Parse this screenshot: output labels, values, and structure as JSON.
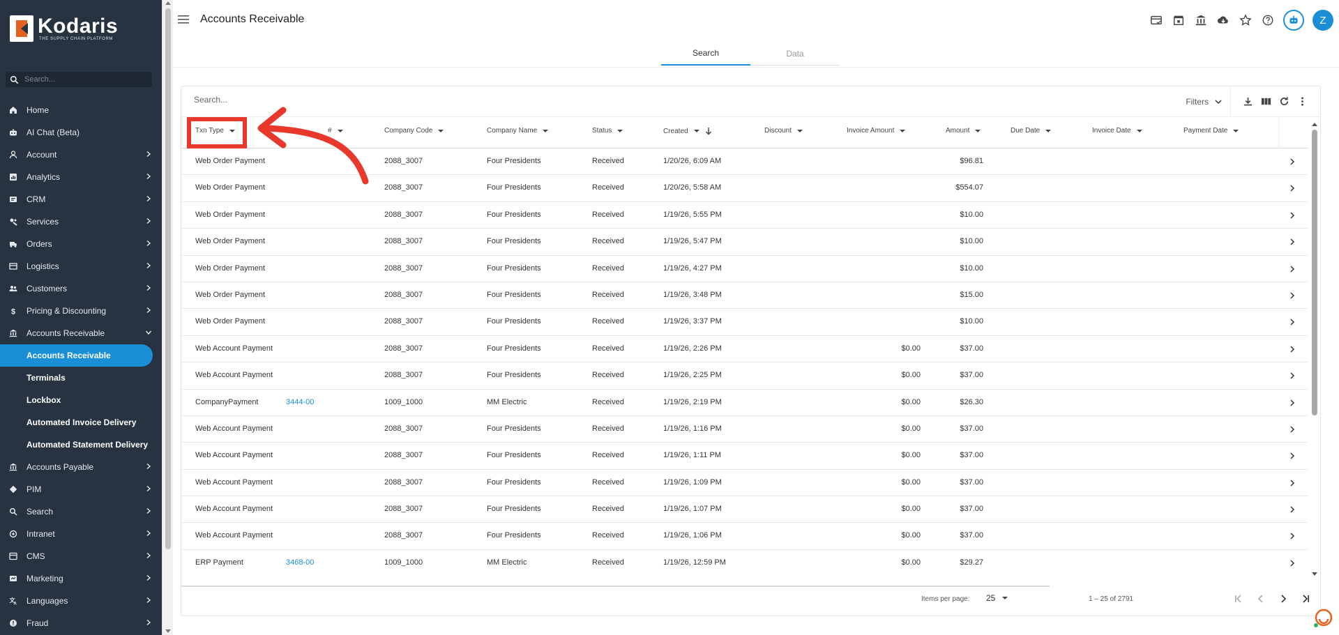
{
  "brand": {
    "name": "Kodaris",
    "tagline": "THE SUPPLY CHAIN PLATFORM"
  },
  "sidebar": {
    "search_placeholder": "Search...",
    "items": [
      {
        "label": "Home",
        "icon": "home-icon",
        "has_chevron": false
      },
      {
        "label": "AI Chat (Beta)",
        "icon": "robot-icon",
        "has_chevron": false
      },
      {
        "label": "Account",
        "icon": "person-icon",
        "has_chevron": true
      },
      {
        "label": "Analytics",
        "icon": "analytics-icon",
        "has_chevron": true
      },
      {
        "label": "CRM",
        "icon": "crm-icon",
        "has_chevron": true
      },
      {
        "label": "Services",
        "icon": "services-icon",
        "has_chevron": true
      },
      {
        "label": "Orders",
        "icon": "truck-icon",
        "has_chevron": true
      },
      {
        "label": "Logistics",
        "icon": "logistics-icon",
        "has_chevron": true
      },
      {
        "label": "Customers",
        "icon": "people-icon",
        "has_chevron": true
      },
      {
        "label": "Pricing & Discounting",
        "icon": "dollar-icon",
        "has_chevron": true
      },
      {
        "label": "Accounts Receivable",
        "icon": "bank-icon",
        "has_chevron": true,
        "expanded": true
      }
    ],
    "sub_items": [
      {
        "label": "Accounts Receivable",
        "active": true
      },
      {
        "label": "Terminals",
        "active": false
      },
      {
        "label": "Lockbox",
        "active": false
      },
      {
        "label": "Automated Invoice Delivery",
        "active": false
      },
      {
        "label": "Automated Statement Delivery",
        "active": false
      }
    ],
    "items_after": [
      {
        "label": "Accounts Payable",
        "icon": "bank-icon",
        "has_chevron": true
      },
      {
        "label": "PIM",
        "icon": "tag-icon",
        "has_chevron": true
      },
      {
        "label": "Search",
        "icon": "search-icon",
        "has_chevron": true
      },
      {
        "label": "Intranet",
        "icon": "intranet-icon",
        "has_chevron": true
      },
      {
        "label": "CMS",
        "icon": "cms-icon",
        "has_chevron": true
      },
      {
        "label": "Marketing",
        "icon": "marketing-icon",
        "has_chevron": true
      },
      {
        "label": "Languages",
        "icon": "translate-icon",
        "has_chevron": true
      },
      {
        "label": "Fraud",
        "icon": "alert-icon",
        "has_chevron": true
      }
    ]
  },
  "header": {
    "title": "Accounts Receivable",
    "icons": [
      "payment-card-icon",
      "storefront-icon",
      "bank-icon",
      "cloud-download-icon",
      "star-icon",
      "help-icon"
    ],
    "avatar_initial": "Z"
  },
  "tabs": [
    {
      "label": "Search",
      "active": true
    },
    {
      "label": "Data",
      "active": false
    }
  ],
  "grid": {
    "search_placeholder": "Search...",
    "filters_label": "Filters",
    "columns": [
      {
        "label": "Txn Type"
      },
      {
        "label": "#"
      },
      {
        "label": "Company Code"
      },
      {
        "label": "Company Name"
      },
      {
        "label": "Status"
      },
      {
        "label": "Created",
        "sorted": "desc"
      },
      {
        "label": "Discount"
      },
      {
        "label": "Invoice Amount"
      },
      {
        "label": "Amount"
      },
      {
        "label": "Due Date"
      },
      {
        "label": "Invoice Date"
      },
      {
        "label": "Payment Date"
      }
    ],
    "rows": [
      {
        "txn_type": "Web Order Payment",
        "num": "",
        "company_code": "2088_3007",
        "company_name": "Four Presidents",
        "status": "Received",
        "created": "1/20/26, 6:09 AM",
        "invoice_amount": "",
        "amount": "$96.81"
      },
      {
        "txn_type": "Web Order Payment",
        "num": "",
        "company_code": "2088_3007",
        "company_name": "Four Presidents",
        "status": "Received",
        "created": "1/20/26, 5:58 AM",
        "invoice_amount": "",
        "amount": "$554.07"
      },
      {
        "txn_type": "Web Order Payment",
        "num": "",
        "company_code": "2088_3007",
        "company_name": "Four Presidents",
        "status": "Received",
        "created": "1/19/26, 5:55 PM",
        "invoice_amount": "",
        "amount": "$10.00"
      },
      {
        "txn_type": "Web Order Payment",
        "num": "",
        "company_code": "2088_3007",
        "company_name": "Four Presidents",
        "status": "Received",
        "created": "1/19/26, 5:47 PM",
        "invoice_amount": "",
        "amount": "$10.00"
      },
      {
        "txn_type": "Web Order Payment",
        "num": "",
        "company_code": "2088_3007",
        "company_name": "Four Presidents",
        "status": "Received",
        "created": "1/19/26, 4:27 PM",
        "invoice_amount": "",
        "amount": "$10.00"
      },
      {
        "txn_type": "Web Order Payment",
        "num": "",
        "company_code": "2088_3007",
        "company_name": "Four Presidents",
        "status": "Received",
        "created": "1/19/26, 3:48 PM",
        "invoice_amount": "",
        "amount": "$15.00"
      },
      {
        "txn_type": "Web Order Payment",
        "num": "",
        "company_code": "2088_3007",
        "company_name": "Four Presidents",
        "status": "Received",
        "created": "1/19/26, 3:37 PM",
        "invoice_amount": "",
        "amount": "$10.00"
      },
      {
        "txn_type": "Web Account Payment",
        "num": "",
        "company_code": "2088_3007",
        "company_name": "Four Presidents",
        "status": "Received",
        "created": "1/19/26, 2:26 PM",
        "invoice_amount": "$0.00",
        "amount": "$37.00"
      },
      {
        "txn_type": "Web Account Payment",
        "num": "",
        "company_code": "2088_3007",
        "company_name": "Four Presidents",
        "status": "Received",
        "created": "1/19/26, 2:25 PM",
        "invoice_amount": "$0.00",
        "amount": "$37.00"
      },
      {
        "txn_type": "CompanyPayment",
        "num": "3444-00",
        "company_code": "1009_1000",
        "company_name": "MM Electric",
        "status": "Received",
        "created": "1/19/26, 2:19 PM",
        "invoice_amount": "$0.00",
        "amount": "$26.30"
      },
      {
        "txn_type": "Web Account Payment",
        "num": "",
        "company_code": "2088_3007",
        "company_name": "Four Presidents",
        "status": "Received",
        "created": "1/19/26, 1:16 PM",
        "invoice_amount": "$0.00",
        "amount": "$37.00"
      },
      {
        "txn_type": "Web Account Payment",
        "num": "",
        "company_code": "2088_3007",
        "company_name": "Four Presidents",
        "status": "Received",
        "created": "1/19/26, 1:11 PM",
        "invoice_amount": "$0.00",
        "amount": "$37.00"
      },
      {
        "txn_type": "Web Account Payment",
        "num": "",
        "company_code": "2088_3007",
        "company_name": "Four Presidents",
        "status": "Received",
        "created": "1/19/26, 1:09 PM",
        "invoice_amount": "$0.00",
        "amount": "$37.00"
      },
      {
        "txn_type": "Web Account Payment",
        "num": "",
        "company_code": "2088_3007",
        "company_name": "Four Presidents",
        "status": "Received",
        "created": "1/19/26, 1:07 PM",
        "invoice_amount": "$0.00",
        "amount": "$37.00"
      },
      {
        "txn_type": "Web Account Payment",
        "num": "",
        "company_code": "2088_3007",
        "company_name": "Four Presidents",
        "status": "Received",
        "created": "1/19/26, 1:06 PM",
        "invoice_amount": "$0.00",
        "amount": "$37.00"
      },
      {
        "txn_type": "ERP Payment",
        "num": "3468-00",
        "company_code": "1009_1000",
        "company_name": "MM Electric",
        "status": "Received",
        "created": "1/19/26, 12:59 PM",
        "invoice_amount": "$0.00",
        "amount": "$29.27"
      }
    ]
  },
  "paginator": {
    "items_per_page_label": "Items per page:",
    "items_per_page": "25",
    "range_label": "1 – 25 of 2791"
  },
  "colors": {
    "sidebar_bg": "#273341",
    "accent": "#1a8fd6",
    "brand_orange": "#e3621f",
    "annotation_red": "#e8372b"
  }
}
